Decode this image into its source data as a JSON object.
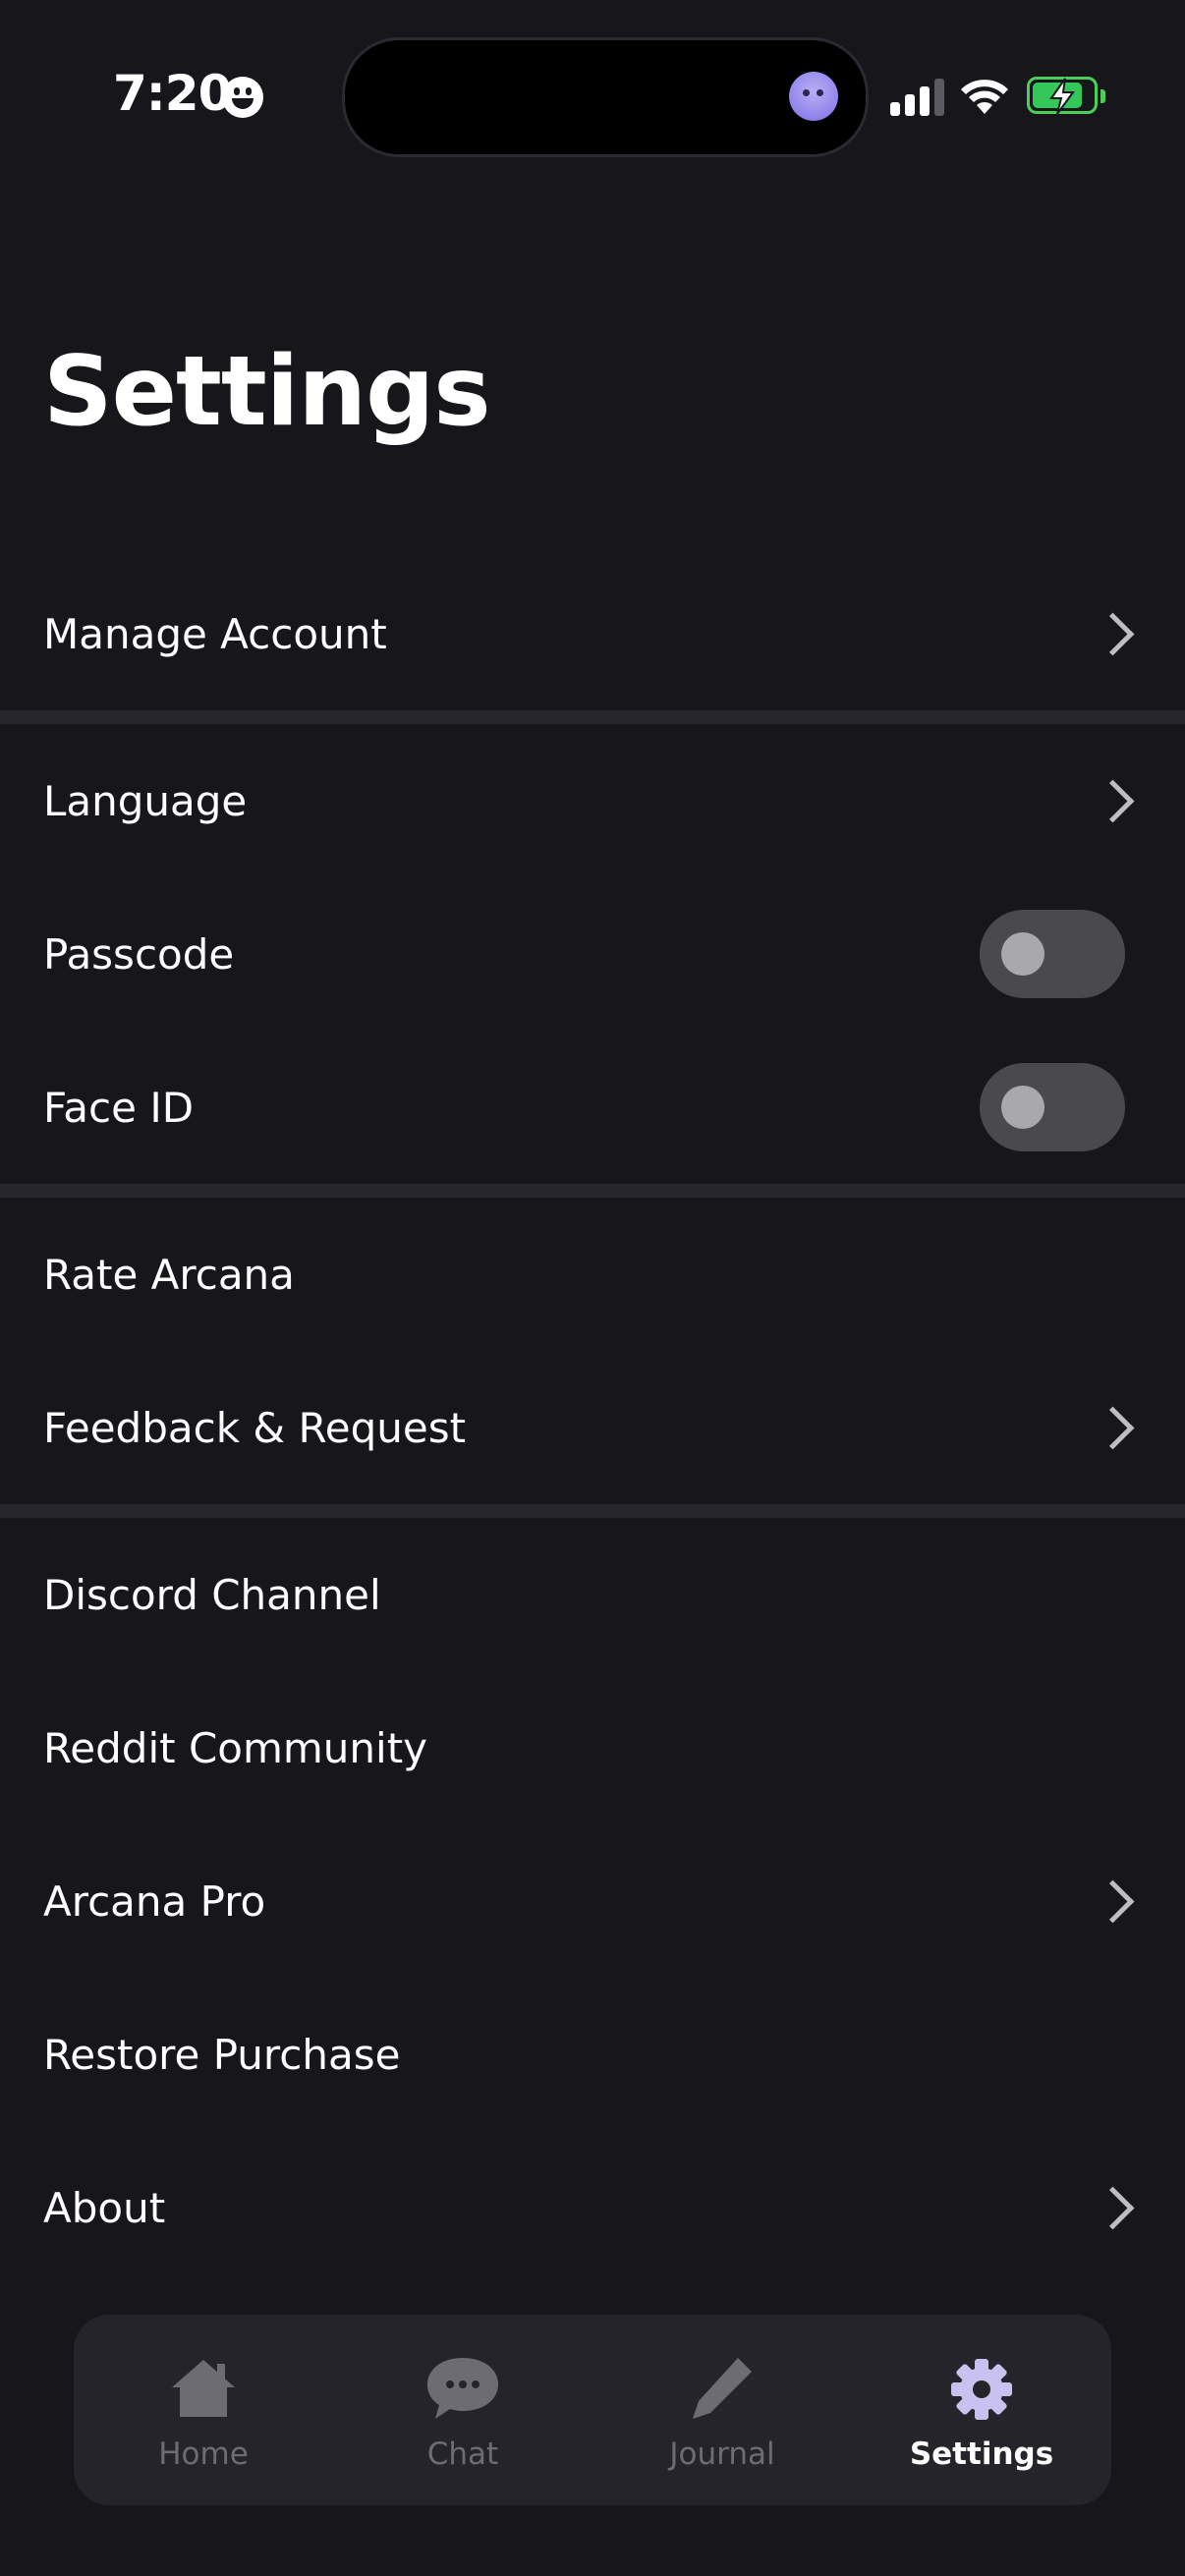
{
  "status_bar": {
    "time": "7:20"
  },
  "page": {
    "title": "Settings"
  },
  "settings": {
    "items": [
      {
        "label": "Manage Account",
        "control": "chevron"
      },
      {
        "label": "Language",
        "control": "chevron"
      },
      {
        "label": "Passcode",
        "control": "toggle",
        "enabled": false
      },
      {
        "label": "Face ID",
        "control": "toggle",
        "enabled": false
      },
      {
        "label": "Rate Arcana",
        "control": "none"
      },
      {
        "label": "Feedback & Request",
        "control": "chevron"
      },
      {
        "label": "Discord Channel",
        "control": "none"
      },
      {
        "label": "Reddit Community",
        "control": "none"
      },
      {
        "label": "Arcana Pro",
        "control": "chevron"
      },
      {
        "label": "Restore Purchase",
        "control": "none"
      },
      {
        "label": "About",
        "control": "chevron"
      }
    ]
  },
  "tab_bar": {
    "tabs": [
      {
        "label": "Home",
        "icon": "home-icon",
        "active": false
      },
      {
        "label": "Chat",
        "icon": "chat-bubble-icon",
        "active": false
      },
      {
        "label": "Journal",
        "icon": "pencil-icon",
        "active": false
      },
      {
        "label": "Settings",
        "icon": "gear-icon",
        "active": true
      }
    ]
  },
  "colors": {
    "background": "#17161b",
    "separator": "#27262d",
    "tab_bar_bg": "#25242b",
    "inactive_tab": "#6d6c73",
    "active_icon": "#c9c2f0",
    "toggle_off": "#4a4a4e"
  }
}
